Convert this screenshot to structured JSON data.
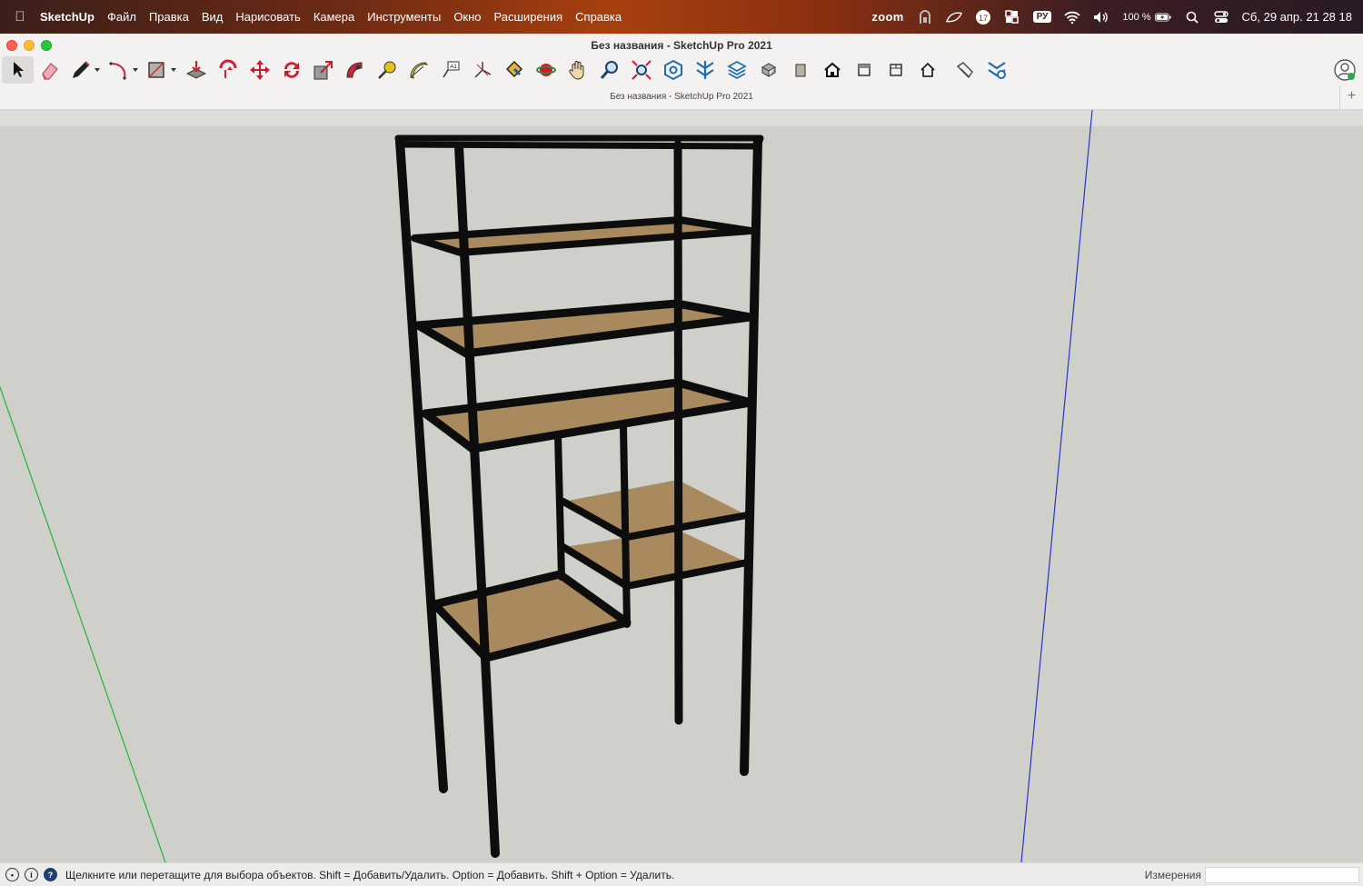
{
  "menubar": {
    "app_name": "SketchUp",
    "items": [
      "Файл",
      "Правка",
      "Вид",
      "Нарисовать",
      "Камера",
      "Инструменты",
      "Окно",
      "Расширения",
      "Справка"
    ],
    "zoom": "zoom",
    "input_lang": "РУ",
    "battery": "100 %",
    "clock": "Сб, 29 апр.  21 28 18",
    "calendar_badge": "17"
  },
  "window": {
    "title": "Без названия - SketchUp Pro 2021",
    "tab_title": "Без названия - SketchUp Pro 2021",
    "tab_add": "+"
  },
  "toolbar": {
    "tools": [
      {
        "name": "select-tool",
        "icon": "arrow-icon"
      },
      {
        "name": "eraser-tool",
        "icon": "eraser-icon"
      },
      {
        "name": "line-tool",
        "icon": "pencil-icon"
      },
      {
        "name": "arc-tool",
        "icon": "arc-icon"
      },
      {
        "name": "shape-tool",
        "icon": "rectangle-icon"
      },
      {
        "name": "push-pull-tool",
        "icon": "push-pull-icon"
      },
      {
        "name": "offset-tool",
        "icon": "offset-icon"
      },
      {
        "name": "move-tool",
        "icon": "move-icon"
      },
      {
        "name": "rotate-tool",
        "icon": "rotate-icon"
      },
      {
        "name": "scale-tool",
        "icon": "scale-icon"
      },
      {
        "name": "follow-me-tool",
        "icon": "follow-me-icon"
      },
      {
        "name": "tape-measure-tool",
        "icon": "tape-icon"
      },
      {
        "name": "protractor-tool",
        "icon": "protractor-icon"
      },
      {
        "name": "text-tool",
        "icon": "text-icon"
      },
      {
        "name": "axes-tool",
        "icon": "axes-icon"
      },
      {
        "name": "paint-bucket-tool",
        "icon": "paint-bucket-icon"
      },
      {
        "name": "orbit-tool",
        "icon": "orbit-icon"
      },
      {
        "name": "pan-tool",
        "icon": "hand-icon"
      },
      {
        "name": "zoom-tool",
        "icon": "magnifier-icon"
      },
      {
        "name": "zoom-extents-tool",
        "icon": "zoom-extents-icon"
      },
      {
        "name": "warehouse-tool",
        "icon": "warehouse-icon"
      },
      {
        "name": "extension-warehouse-tool",
        "icon": "extension-warehouse-icon"
      },
      {
        "name": "layout-tool",
        "icon": "layout-icon"
      },
      {
        "name": "view-iso-tool",
        "icon": "iso-view-icon"
      },
      {
        "name": "view-front-tool",
        "icon": "front-view-icon"
      },
      {
        "name": "view-home-tool",
        "icon": "house-icon"
      },
      {
        "name": "view-right-tool",
        "icon": "right-view-icon"
      },
      {
        "name": "view-back-tool",
        "icon": "back-view-icon"
      },
      {
        "name": "view-left-tool",
        "icon": "left-view-icon"
      },
      {
        "name": "sandbox-tool",
        "icon": "sandbox-icon"
      },
      {
        "name": "extension-manager-tool",
        "icon": "extension-manager-icon"
      }
    ]
  },
  "status": {
    "hint": "Щелкните или перетащите для выбора объектов. Shift = Добавить/Удалить. Option = Добавить. Shift + Option = Удалить.",
    "measurements_label": "Измерения",
    "measurements_value": ""
  },
  "colors": {
    "green_axis": "#22b43a",
    "blue_axis": "#2a34c8",
    "frame": "#0d0d0d",
    "wood": "#a88a5e"
  }
}
